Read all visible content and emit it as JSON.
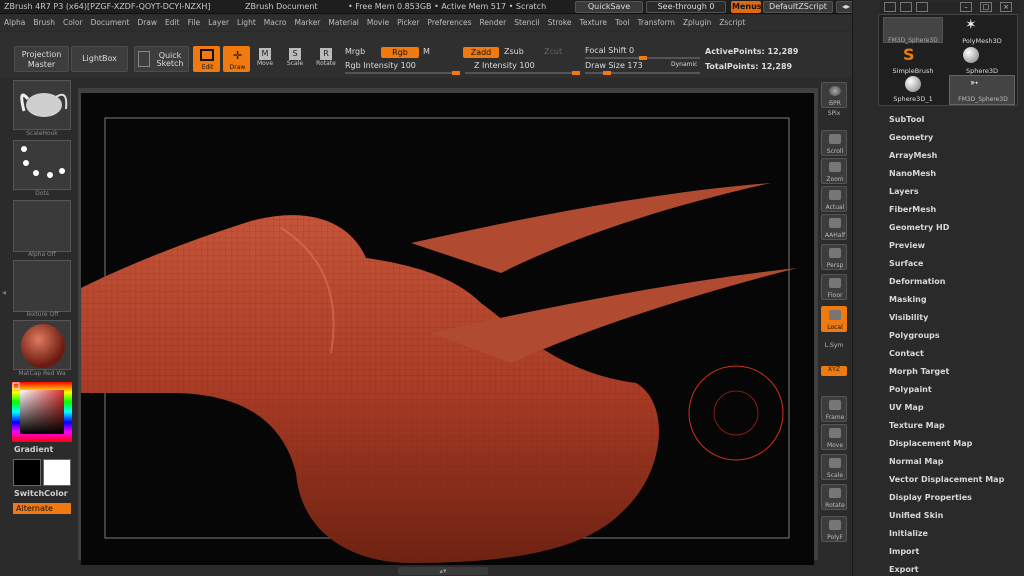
{
  "titlebar": {
    "app_title": "ZBrush 4R7 P3 (x64)[PZGF-XZDF-QOYT-DCYI-NZXH]",
    "document": "ZBrush Document",
    "mem_info": "• Free Mem 0.853GB • Active Mem 517 • Scratch",
    "quicksave": "QuickSave",
    "see_through": "See-through  0",
    "menus": "Menus",
    "default_script": "DefaultZScript"
  },
  "menubar": [
    "Alpha",
    "Brush",
    "Color",
    "Document",
    "Draw",
    "Edit",
    "File",
    "Layer",
    "Light",
    "Macro",
    "Marker",
    "Material",
    "Movie",
    "Picker",
    "Preferences",
    "Render",
    "Stencil",
    "Stroke",
    "Texture",
    "Tool",
    "Transform",
    "Zplugin",
    "Zscript"
  ],
  "toolbar": {
    "projection_master": "Projection Master",
    "lightbox": "LightBox",
    "quick_sketch": "Quick Sketch",
    "edit": "Edit",
    "draw": "Draw",
    "move": "Move",
    "scale": "Scale",
    "rotate": "Rotate",
    "mrgb": "Mrgb",
    "rgb": "Rgb",
    "m": "M",
    "zadd": "Zadd",
    "zsub": "Zsub",
    "zcut": "Zcut",
    "rgb_intensity": "Rgb Intensity 100",
    "z_intensity": "Z Intensity 100",
    "focal_shift": "Focal Shift 0",
    "draw_size": "Draw Size 173",
    "dynamic": "Dynamic",
    "active_points": "ActivePoints: 12,289",
    "total_points": "TotalPoints: 12,289",
    "rgb_intensity_level": 1.0,
    "z_intensity_level": 1.0,
    "focal_shift_level": 0.0,
    "draw_size_level": 0.17
  },
  "leftshelf": {
    "brush_caption": "ScaleHook",
    "stroke_caption": "Dots",
    "alpha_caption": "Alpha  Off",
    "texture_caption": "Texture  Off",
    "material_caption": "MatCap Red Wa",
    "gradient": "Gradient",
    "switch_color": "SwitchColor",
    "alternate": "Alternate"
  },
  "rightshelf": [
    {
      "name": "bpr",
      "label": "BPR"
    },
    {
      "name": "spix",
      "label": "SPix"
    },
    {
      "name": "scroll",
      "label": "Scroll"
    },
    {
      "name": "zoom",
      "label": "Zoom"
    },
    {
      "name": "actual",
      "label": "Actual"
    },
    {
      "name": "aahalf",
      "label": "AAHalf"
    },
    {
      "name": "persp",
      "label": "Persp"
    },
    {
      "name": "floor",
      "label": "Floor"
    },
    {
      "name": "local",
      "label": "Local"
    },
    {
      "name": "lsym",
      "label": "L.Sym"
    },
    {
      "name": "xyz",
      "label": "XYZ"
    },
    {
      "name": "frame",
      "label": "Frame"
    },
    {
      "name": "move",
      "label": "Move"
    },
    {
      "name": "scale",
      "label": "Scale"
    },
    {
      "name": "rotate",
      "label": "Rotate"
    },
    {
      "name": "polyf",
      "label": "PolyF"
    }
  ],
  "palette": {
    "items": [
      "FM3D_Sphere3D",
      "PolyMesh3D",
      "SimpleBrush",
      "Sphere3D",
      "Sphere3D_1",
      "FM3D_Sphere3D"
    ]
  },
  "toolpanel": [
    "SubTool",
    "Geometry",
    "ArrayMesh",
    "NanoMesh",
    "Layers",
    "FiberMesh",
    "Geometry HD",
    "Preview",
    "Surface",
    "Deformation",
    "Masking",
    "Visibility",
    "Polygroups",
    "Contact",
    "Morph Target",
    "Polypaint",
    "UV Map",
    "Texture Map",
    "Displacement Map",
    "Normal Map",
    "Vector Displacement Map",
    "Display Properties",
    "Unified Skin",
    "Initialize",
    "Import",
    "Export"
  ],
  "colors": {
    "accent": "#f07a10",
    "mesh": "#b5432c",
    "background": "#060606"
  }
}
